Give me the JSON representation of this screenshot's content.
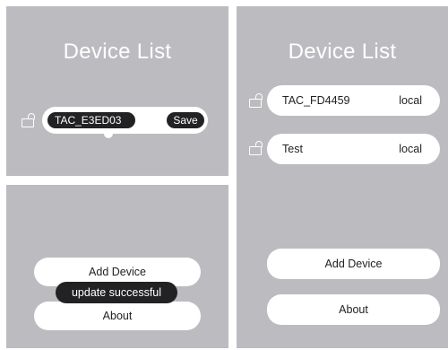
{
  "panel1": {
    "title": "Device List",
    "device_name": "TAC_E3ED03",
    "save_label": "Save"
  },
  "panel2": {
    "add_device_label": "Add Device",
    "toast": "update successful",
    "about_label": "About"
  },
  "panel3": {
    "title": "Device List",
    "devices": [
      {
        "name": "TAC_FD4459",
        "status": "local"
      },
      {
        "name": "Test",
        "status": "local"
      }
    ],
    "add_device_label": "Add Device",
    "about_label": "About"
  }
}
